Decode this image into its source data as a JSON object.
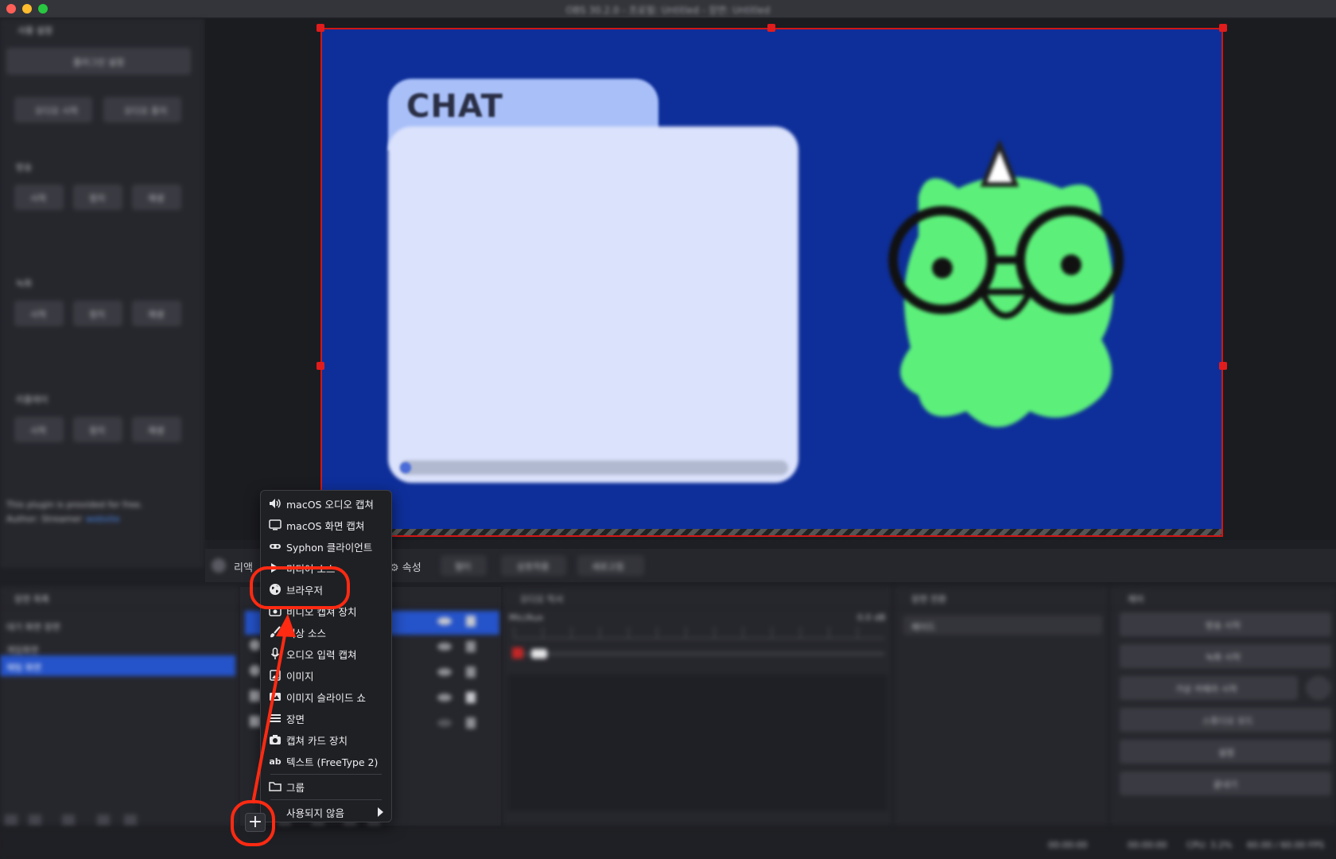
{
  "window": {
    "title": "OBS 30.2.0 - 프로필: Untitled - 장면: Untitled"
  },
  "left_panel": {
    "dock_title": "사용 설정",
    "top_button": "플러그인 설정",
    "pair_buttons": [
      "오디오 시작",
      "오디오 중지"
    ],
    "groups": [
      {
        "label": "방송",
        "buttons": [
          "시작",
          "정지",
          "재생"
        ]
      },
      {
        "label": "녹화",
        "buttons": [
          "시작",
          "정지",
          "재생"
        ]
      },
      {
        "label": "리플레이",
        "buttons": [
          "시작",
          "정지",
          "재생"
        ]
      }
    ],
    "footer_line1": "This plugin is provided for free.",
    "footer_line2": "Author: Streamer",
    "footer_link": "website"
  },
  "preview": {
    "chat_title": "CHAT"
  },
  "controls_bar": {
    "left_label": "리액",
    "properties_label": "속성",
    "filters_label": "필터",
    "interact_label": "상호작용",
    "extra_label": "새로고침"
  },
  "scenes_dock": {
    "title": "장면 목록",
    "items": [
      "대기 화면 장면",
      "게임화면",
      "채팅 화면"
    ]
  },
  "audio_dock": {
    "title": "오디오 믹서",
    "track_name": "Mic/Aux",
    "db_value": "0.0 dB"
  },
  "transition_dock": {
    "title": "장면 전환",
    "selected": "페이드"
  },
  "controls_dock": {
    "title": "제어",
    "buttons": [
      "방송 시작",
      "녹화 시작",
      "가상 카메라 시작",
      "스튜디오 모드",
      "설정",
      "끝내기"
    ]
  },
  "status_bar": {
    "items": [
      "00:00:00",
      "00:00:00",
      "CPU: 3.2%",
      "60.00 / 60.00 FPS"
    ]
  },
  "context_menu": {
    "items": [
      {
        "icon": "speaker-icon",
        "label": "macOS 오디오 캡쳐"
      },
      {
        "icon": "monitor-icon",
        "label": "macOS 화면 캡쳐"
      },
      {
        "icon": "syphon-icon",
        "label": "Syphon 클라이언트"
      },
      {
        "icon": "play-icon",
        "label": "미디어 소스"
      },
      {
        "icon": "globe-icon",
        "label": "브라우저"
      },
      {
        "icon": "camera-icon",
        "label": "비디오 캡쳐 장치"
      },
      {
        "icon": "paint-brush-icon",
        "label": "색상 소스"
      },
      {
        "icon": "microphone-icon",
        "label": "오디오 입력 캡쳐"
      },
      {
        "icon": "image-icon",
        "label": "이미지"
      },
      {
        "icon": "slideshow-icon",
        "label": "이미지 슬라이드 쇼"
      },
      {
        "icon": "list-icon",
        "label": "장면"
      },
      {
        "icon": "capture-card-icon",
        "label": "캡쳐 카드 장치"
      },
      {
        "icon": "text-icon",
        "label": "텍스트 (FreeType 2)"
      }
    ],
    "group_label": "그룹",
    "deprecated_label": "사용되지 않음",
    "text_icon_glyph": "ab"
  },
  "add_button_glyph": "+",
  "colors": {
    "canvas_blue": "#0e2f9a",
    "annotation_red": "#ff2a12",
    "selection_blue": "#2553c9",
    "mascot_green": "#5cf07a"
  }
}
